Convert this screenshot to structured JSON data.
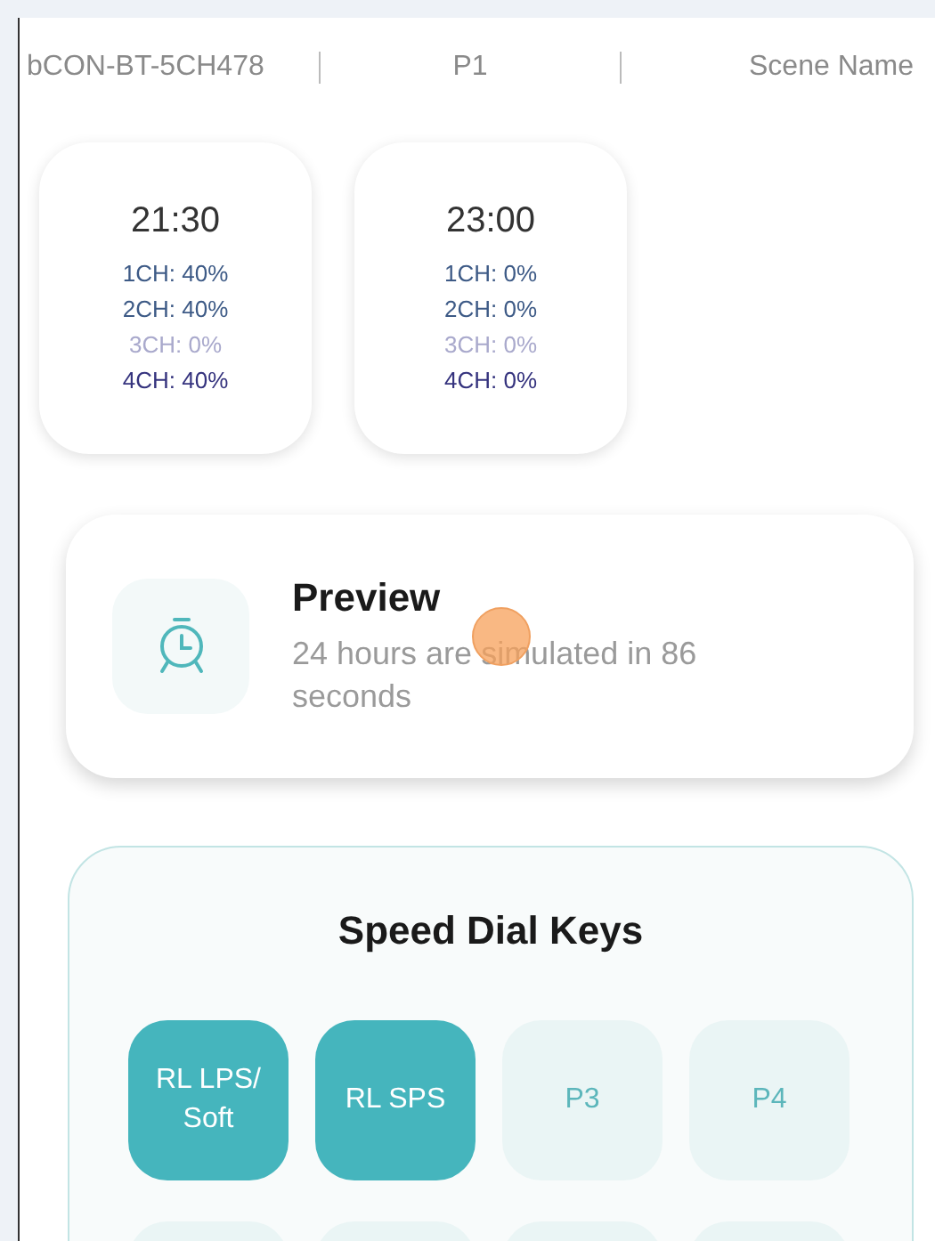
{
  "header": {
    "device": "bCON-BT-5CH478",
    "program": "P1",
    "scene": "Scene Name"
  },
  "time_points": [
    {
      "time": "21:30",
      "channels": [
        {
          "label": "1CH: 40%",
          "color": "#3d5a86"
        },
        {
          "label": "2CH: 40%",
          "color": "#3d5a86"
        },
        {
          "label": "3CH: 0%",
          "color": "#a9a9cc"
        },
        {
          "label": "4CH: 40%",
          "color": "#35337e"
        }
      ]
    },
    {
      "time": "23:00",
      "channels": [
        {
          "label": "1CH: 0%",
          "color": "#3d5a86"
        },
        {
          "label": "2CH: 0%",
          "color": "#3d5a86"
        },
        {
          "label": "3CH: 0%",
          "color": "#a9a9cc"
        },
        {
          "label": "4CH: 0%",
          "color": "#35337e"
        }
      ]
    }
  ],
  "preview": {
    "title": "Preview",
    "subtitle": "24 hours are simulated in 86 seconds"
  },
  "touch_indicator": true,
  "speed_dial": {
    "title": "Speed Dial Keys",
    "keys": [
      {
        "label": "RL LPS/ Soft",
        "filled": true
      },
      {
        "label": "RL SPS",
        "filled": true
      },
      {
        "label": "P3",
        "filled": false
      },
      {
        "label": "P4",
        "filled": false
      },
      {
        "filled": false
      },
      {
        "filled": false
      },
      {
        "filled": false
      },
      {
        "filled": false
      }
    ]
  }
}
